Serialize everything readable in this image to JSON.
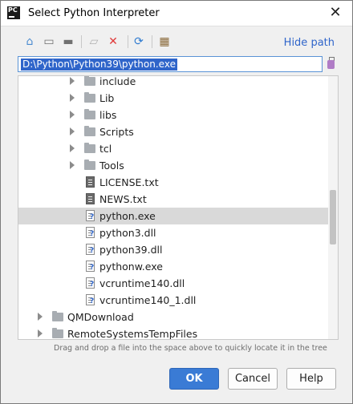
{
  "dialog": {
    "app_icon_text": "PC",
    "title": "Select Python Interpreter",
    "close_glyph": "✕"
  },
  "toolbar": {
    "buttons": [
      {
        "name": "home-icon",
        "glyph": "⌂",
        "color": "#4a8bd0"
      },
      {
        "name": "desktop-icon",
        "glyph": "▭",
        "color": "#707070"
      },
      {
        "name": "project-folder-icon",
        "glyph": "▬",
        "color": "#707070"
      },
      {
        "name": "new-folder-icon",
        "glyph": "▱",
        "color": "#b0b0b0"
      },
      {
        "name": "delete-icon",
        "glyph": "✕",
        "color": "#e03a3a"
      },
      {
        "name": "refresh-icon",
        "glyph": "⟳",
        "color": "#2f7bd0"
      },
      {
        "name": "show-hidden-icon",
        "glyph": "▦",
        "color": "#8a6a3a"
      }
    ],
    "hide_path_label": "Hide path"
  },
  "path": {
    "value": "D:\\Python\\Python39\\python.exe"
  },
  "tree": {
    "rows": [
      {
        "type": "folder",
        "label": "include",
        "level": 2,
        "selected": false
      },
      {
        "type": "folder",
        "label": "Lib",
        "level": 2,
        "selected": false
      },
      {
        "type": "folder",
        "label": "libs",
        "level": 2,
        "selected": false
      },
      {
        "type": "folder",
        "label": "Scripts",
        "level": 2,
        "selected": false
      },
      {
        "type": "folder",
        "label": "tcl",
        "level": 2,
        "selected": false
      },
      {
        "type": "folder",
        "label": "Tools",
        "level": 2,
        "selected": false
      },
      {
        "type": "txt",
        "label": "LICENSE.txt",
        "level": 2,
        "selected": false
      },
      {
        "type": "txt",
        "label": "NEWS.txt",
        "level": 2,
        "selected": false
      },
      {
        "type": "bin",
        "label": "python.exe",
        "level": 2,
        "selected": true
      },
      {
        "type": "bin",
        "label": "python3.dll",
        "level": 2,
        "selected": false
      },
      {
        "type": "bin",
        "label": "python39.dll",
        "level": 2,
        "selected": false
      },
      {
        "type": "bin",
        "label": "pythonw.exe",
        "level": 2,
        "selected": false
      },
      {
        "type": "bin",
        "label": "vcruntime140.dll",
        "level": 2,
        "selected": false
      },
      {
        "type": "bin",
        "label": "vcruntime140_1.dll",
        "level": 2,
        "selected": false
      },
      {
        "type": "folder",
        "label": "QMDownload",
        "level": 1,
        "selected": false
      },
      {
        "type": "folder",
        "label": "RemoteSystemsTempFiles",
        "level": 1,
        "selected": false
      }
    ]
  },
  "hint": "Drag and drop a file into the space above to quickly locate it in the tree",
  "buttons": {
    "ok": "OK",
    "cancel": "Cancel",
    "help": "Help"
  }
}
